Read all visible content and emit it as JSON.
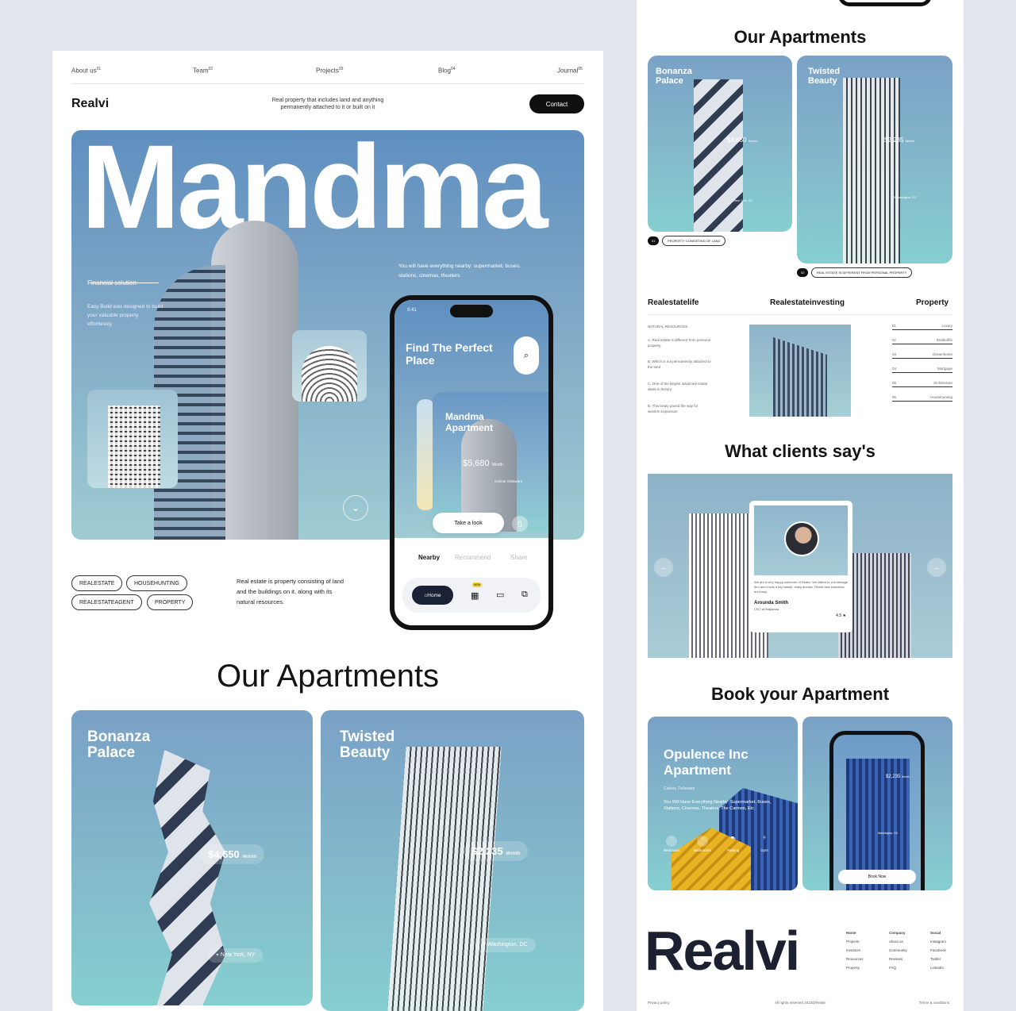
{
  "left": {
    "nav": [
      {
        "label": "About us",
        "num": "01"
      },
      {
        "label": "Team",
        "num": "02"
      },
      {
        "label": "Projects",
        "num": "03"
      },
      {
        "label": "Blog",
        "num": "04"
      },
      {
        "label": "Journal",
        "num": "05"
      }
    ],
    "logo": "Realvi",
    "tagline": "Real property that includes land and anything permanently attached to it or built on it",
    "contact_label": "Contact",
    "hero": {
      "headline": "Mandma",
      "sub_title": "Financial solution",
      "sub_text": "Easy Build was designed to build your valuable property effortlessly",
      "nearby_text": "You will have everything nearby: supermarket, buses, stations, cinemas, theaters"
    },
    "phone": {
      "time": "9:41",
      "title": "Find The Perfect Place",
      "card_title": "Mandma Apartment",
      "card_price": "$5,680",
      "card_price_unit": "Month",
      "card_location": "Carlow, Delaware",
      "cta": "Take a look",
      "tabs": [
        "Nearby",
        "Recommend",
        "Share"
      ],
      "home_label": "Home",
      "new_badge": "NEW"
    },
    "tags": [
      "REALESTATE",
      "HOUSEHUNTING",
      "REALESTATEAGENT",
      "PROPERTY"
    ],
    "description": "Real estate is property consisting of land and the buildings on it, along with its natural resources.",
    "apartments_heading": "Our Apartments",
    "apartments": [
      {
        "title": "Bonanza Palace",
        "price": "$4,650",
        "unit": "Month",
        "location": "New York, NY"
      },
      {
        "title": "Twisted Beauty",
        "price": "$2,235",
        "unit": "Month",
        "location": "Washington, DC"
      }
    ]
  },
  "right": {
    "apartments_heading": "Our Apartments",
    "cards": [
      {
        "title": "Bonanza Palace",
        "price": "$4,650",
        "unit": "Month",
        "location": "New York, NY",
        "num": "01",
        "tag": "PROPERTY CONSISTING OF LAND"
      },
      {
        "title": "Twisted Beauty",
        "price": "$2,235",
        "unit": "Month",
        "location": "Washington, DC",
        "num": "02",
        "tag": "REAL ESTATE IS DIFFERENT FROM PERSONAL PROPERTY"
      }
    ],
    "columns": [
      "Realestatelife",
      "Realestateinvesting",
      "Property"
    ],
    "natural_resources": "NATURAL RESOURCES",
    "facts": [
      {
        "letter": "A.",
        "text": "Real estate is different from personal property"
      },
      {
        "letter": "B.",
        "text": "Which is not permanently attached to the land"
      },
      {
        "letter": "C.",
        "text": "One of the largest initial real estate deals in history"
      },
      {
        "letter": "D.",
        "text": "This treaty paved the way for western expansion"
      }
    ],
    "categories": [
      {
        "num": "01",
        "label": "Luxury"
      },
      {
        "num": "02",
        "label": "Realtorlife"
      },
      {
        "num": "03",
        "label": "Dreamhome"
      },
      {
        "num": "04",
        "label": "Mortgage"
      },
      {
        "num": "05",
        "label": "Architecture"
      },
      {
        "num": "06",
        "label": "Househunting"
      }
    ],
    "testimonials_heading": "What clients say's",
    "testimonial": {
      "quote": "We are a very happy customer of Realvi. We talked to a brokerage firm and it was a big hassle, really archaic. Realvi was seamless and easy.",
      "name": "Arounda Smith",
      "role": "CEO at Bidpanda",
      "rating": "4.5 ★"
    },
    "book_heading": "Book your Apartment",
    "book": {
      "title": "Opulence Inc Apartment",
      "location": "Carlow, Delaware",
      "text": "You Will Have Everything Nearby: Supermarket, Buses, Stations, Cinemas, Theaters, The Carmen, Etc.",
      "amenities": [
        {
          "count": "3",
          "label": "Bedrooms"
        },
        {
          "count": "2",
          "label": "Bathrooms"
        },
        {
          "count": "",
          "label": "Parking"
        },
        {
          "count": "",
          "label": "Gym"
        }
      ],
      "phone_price": "$2,235",
      "phone_unit": "Month",
      "phone_location": "Washington, DC",
      "book_now": "Book Now"
    },
    "footer": {
      "logo": "Realvi",
      "cols": [
        {
          "title": "Home",
          "items": [
            "Projects",
            "Investors",
            "Resources",
            "Property"
          ]
        },
        {
          "title": "Company",
          "items": [
            "About us",
            "Community",
            "Reviews",
            "FAQ"
          ]
        },
        {
          "title": "Social",
          "items": [
            "Instagram",
            "Facebook",
            "Twitter",
            "LinkedIn"
          ]
        }
      ],
      "privacy": "Privacy policy",
      "rights": "All rights reserved 2023@Realvi",
      "terms": "Terms & conditions"
    }
  }
}
